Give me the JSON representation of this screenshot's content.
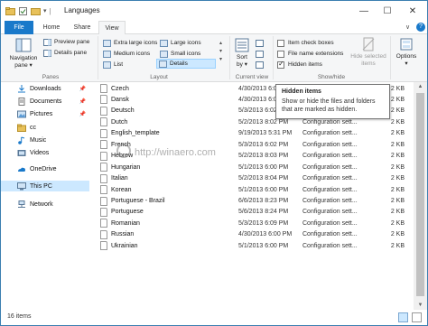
{
  "window": {
    "title": "Languages",
    "minimize_glyph": "—",
    "maximize_glyph": "☐",
    "close_glyph": "✕"
  },
  "tabs": [
    {
      "label": "File"
    },
    {
      "label": "Home"
    },
    {
      "label": "Share"
    },
    {
      "label": "View"
    }
  ],
  "ribbon": {
    "panes": {
      "navigation_pane": "Navigation",
      "navigation_pane_2": "pane ▾",
      "preview_pane": "Preview pane",
      "details_pane": "Details pane",
      "label": "Panes"
    },
    "layout": {
      "items": [
        {
          "label": "Extra large icons"
        },
        {
          "label": "Large icons"
        },
        {
          "label": "Medium icons"
        },
        {
          "label": "Small icons"
        },
        {
          "label": "List"
        },
        {
          "label": "Details"
        }
      ],
      "label": "Layout"
    },
    "current_view": {
      "sort_by": "Sort",
      "sort_by_2": "by ▾",
      "label": "Current view"
    },
    "show_hide": {
      "item_check_boxes": "Item check boxes",
      "file_name_extensions": "File name extensions",
      "hidden_items": "Hidden items",
      "hide_selected": "Hide selected",
      "hide_selected_2": "items",
      "label": "Show/hide"
    },
    "options": {
      "label": "Options",
      "label_2": "▾"
    }
  },
  "nav": {
    "items": [
      {
        "label": "Downloads"
      },
      {
        "label": "Documents"
      },
      {
        "label": "Pictures"
      },
      {
        "label": "cc"
      },
      {
        "label": "Music"
      },
      {
        "label": "Videos"
      },
      {
        "label": "OneDrive"
      },
      {
        "label": "This PC"
      },
      {
        "label": "Network"
      }
    ],
    "pin_glyph": "📌"
  },
  "files": [
    {
      "name": "Czech",
      "date": "4/30/2013 6:00 PM",
      "type": "Configuration sett...",
      "size": "2 KB"
    },
    {
      "name": "Dansk",
      "date": "4/30/2013 6:00 PM",
      "type": "Configuration sett...",
      "size": "2 KB"
    },
    {
      "name": "Deutsch",
      "date": "5/3/2013 6:02 PM",
      "type": "Configuration sett...",
      "size": "2 KB"
    },
    {
      "name": "Dutch",
      "date": "5/2/2013 8:02 PM",
      "type": "Configuration sett...",
      "size": "2 KB"
    },
    {
      "name": "English_template",
      "date": "9/19/2013 5:31 PM",
      "type": "Configuration sett...",
      "size": "2 KB"
    },
    {
      "name": "French",
      "date": "5/3/2013 6:02 PM",
      "type": "Configuration sett...",
      "size": "2 KB"
    },
    {
      "name": "Hebrew",
      "date": "5/2/2013 8:03 PM",
      "type": "Configuration sett...",
      "size": "2 KB"
    },
    {
      "name": "Hungarian",
      "date": "5/1/2013 6:00 PM",
      "type": "Configuration sett...",
      "size": "2 KB"
    },
    {
      "name": "Italian",
      "date": "5/2/2013 8:04 PM",
      "type": "Configuration sett...",
      "size": "2 KB"
    },
    {
      "name": "Korean",
      "date": "5/1/2013 6:00 PM",
      "type": "Configuration sett...",
      "size": "2 KB"
    },
    {
      "name": "Portuguese - Brazil",
      "date": "6/6/2013 8:23 PM",
      "type": "Configuration sett...",
      "size": "2 KB"
    },
    {
      "name": "Portuguese",
      "date": "5/6/2013 8:24 PM",
      "type": "Configuration sett...",
      "size": "2 KB"
    },
    {
      "name": "Romanian",
      "date": "5/3/2013 6:09 PM",
      "type": "Configuration sett...",
      "size": "2 KB"
    },
    {
      "name": "Russian",
      "date": "4/30/2013 6:00 PM",
      "type": "Configuration sett...",
      "size": "2 KB"
    },
    {
      "name": "Ukrainian",
      "date": "5/1/2013 6:00 PM",
      "type": "Configuration sett...",
      "size": "2 KB"
    }
  ],
  "tooltip": {
    "title": "Hidden items",
    "line1": "Show or hide the files and folders",
    "line2": "that are marked as hidden."
  },
  "watermark": "http://winaero.com",
  "status": {
    "item_count": "16 items"
  },
  "colors": {
    "accent": "#1979ca",
    "selection": "#cce8ff"
  }
}
